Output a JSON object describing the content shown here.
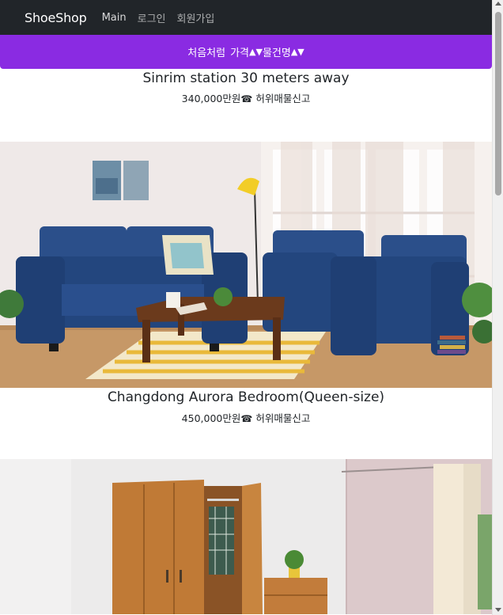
{
  "navbar": {
    "brand": "ShoeShop",
    "links": [
      {
        "label": "Main",
        "active": true
      },
      {
        "label": "로그인",
        "active": false
      },
      {
        "label": "회원가입",
        "active": false
      }
    ]
  },
  "sortbar": {
    "reset_label": "처음처럼",
    "price_label": "가격",
    "name_label": "물건명",
    "asc_arrow": "▲",
    "desc_arrow": "▼",
    "color": "#8a2be2"
  },
  "products": [
    {
      "title": "Sinrim station 30 meters away",
      "price": "340,000만원",
      "phone_icon": "☎",
      "report": "허위매물신고"
    },
    {
      "title": "Changdong Aurora Bedroom(Queen-size)",
      "price": "450,000만원",
      "phone_icon": "☎",
      "report": "허위매물신고",
      "image": "living-room-sofa-photo"
    },
    {
      "image": "bedroom-wardrobe-photo"
    }
  ]
}
